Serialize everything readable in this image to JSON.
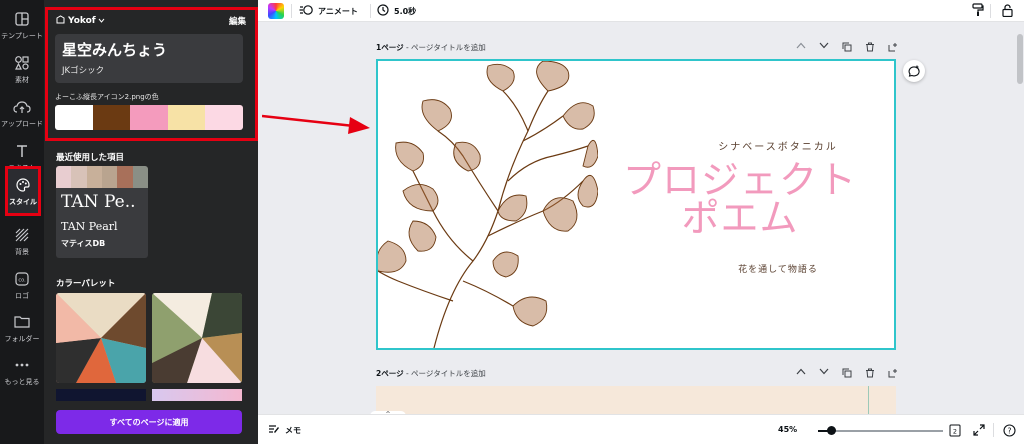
{
  "rail": {
    "items": [
      {
        "label": "テンプレート",
        "icon": "template-icon"
      },
      {
        "label": "素材",
        "icon": "elements-icon"
      },
      {
        "label": "アップロード",
        "icon": "upload-icon"
      },
      {
        "label": "テキスト",
        "icon": "text-icon"
      },
      {
        "label": "スタイル",
        "icon": "style-icon",
        "active": true
      },
      {
        "label": "背景",
        "icon": "background-icon"
      },
      {
        "label": "ロゴ",
        "icon": "logo-icon"
      },
      {
        "label": "フォルダー",
        "icon": "folder-icon"
      },
      {
        "label": "もっと見る",
        "icon": "more-icon"
      }
    ]
  },
  "panel": {
    "brand_kit": "Yokof",
    "edit_label": "編集",
    "font_title": "星空みんちょう",
    "font_sub": "JKゴシック",
    "palette_label": "よーこふ縦長アイコン2.pngの色",
    "palette_colors": [
      "#ffffff",
      "#6b3a12",
      "#f49bbd",
      "#f7e2a6",
      "#fcd9e4"
    ],
    "recent_title": "最近使用した項目",
    "recent_strip": [
      "#e8cdd0",
      "#d8c2b8",
      "#c8b09a",
      "#b9a48f",
      "#a8705a",
      "#8a8f86"
    ],
    "recent_big": "TAN Pe..",
    "recent_mid": "TAN Pearl",
    "recent_small": "マティスDB",
    "color_palette_title": "カラーパレット",
    "apply_button": "すべてのページに適用"
  },
  "topbar": {
    "animate_label": "アニメート",
    "duration_label": "5.0秒"
  },
  "canvas": {
    "page1_num": "1ページ",
    "page1_hint": " - ページタイトルを追加",
    "page2_num": "2ページ",
    "page2_hint": " - ページタイトルを追加",
    "design": {
      "subtitle": "シナベースボタニカル",
      "title_line1": "プロジェクト",
      "title_line2": "ポエム",
      "tagline": "花を通して物語る"
    }
  },
  "bottombar": {
    "notes_label": "メモ",
    "zoom": "45%",
    "zoom_fraction": 0.1,
    "page_count": "2"
  },
  "colors": {
    "accent_purple": "#7d2ae8",
    "highlight_red": "#e60012",
    "selection_teal": "#2fc5cb",
    "title_pink": "#f29abd"
  }
}
